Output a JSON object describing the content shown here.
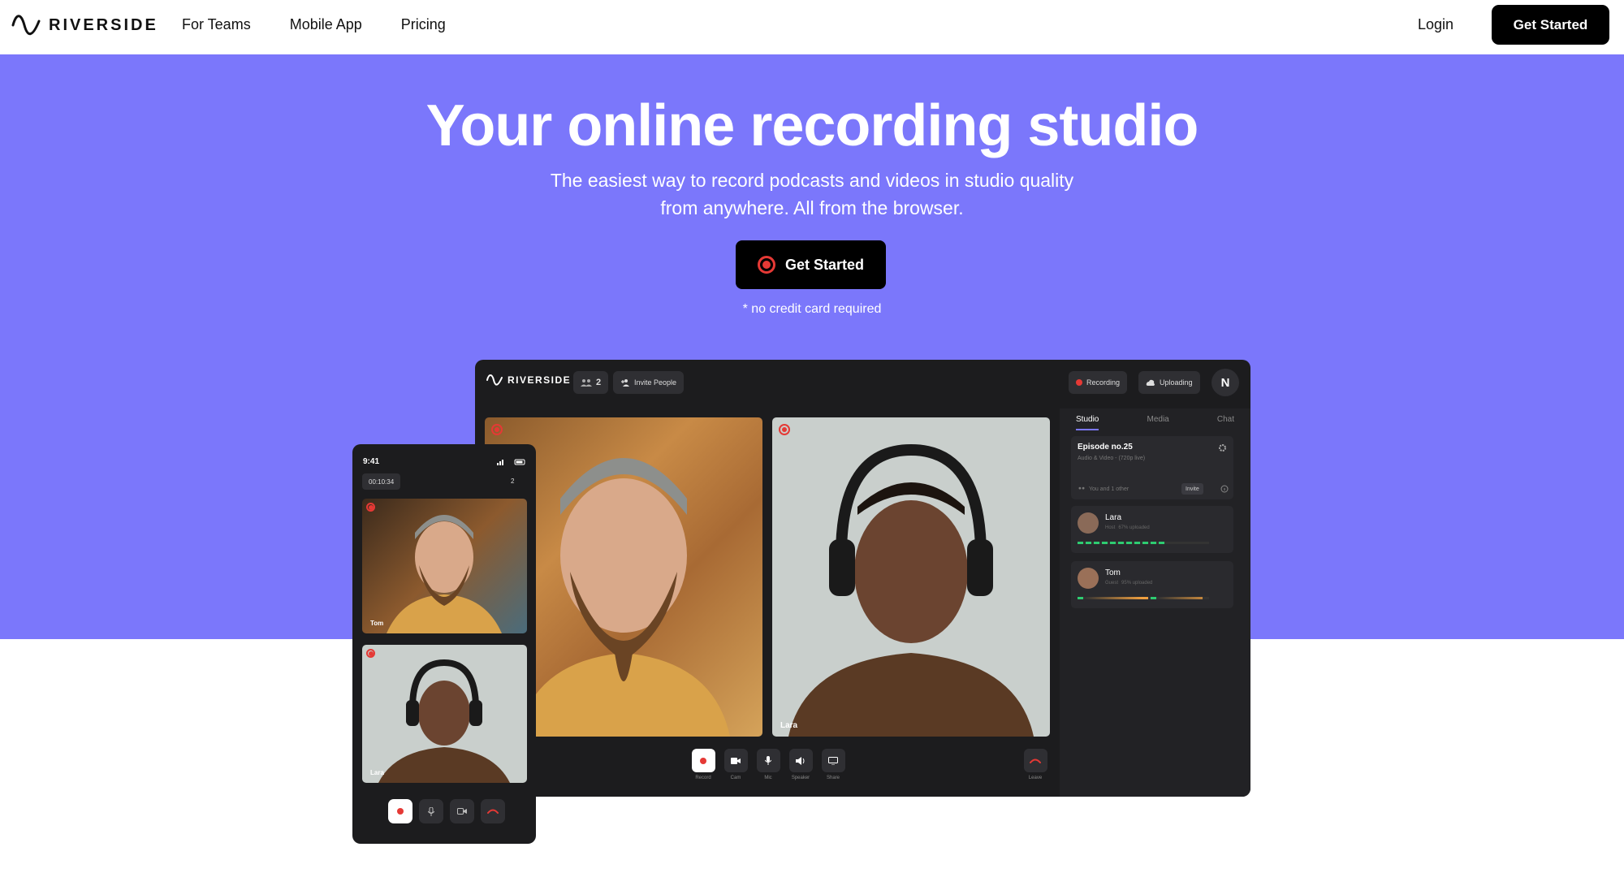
{
  "nav": {
    "brand": "RIVERSIDE",
    "links": [
      "For Teams",
      "Mobile App",
      "Pricing"
    ],
    "login": "Login",
    "cta": "Get Started"
  },
  "hero": {
    "title": "Your online recording studio",
    "subtitle_line1": "The easiest way to record podcasts and videos in studio quality",
    "subtitle_line2": "from anywhere. All from the browser.",
    "cta": "Get Started",
    "note": "* no credit card required",
    "background_color": "#7b77fb"
  },
  "studio_mockup": {
    "brand": "RIVERSIDE",
    "participants_count": "2",
    "invite_label": "Invite People",
    "recording_label": "Recording",
    "uploading_label": "Uploading",
    "avatar_initial": "N",
    "video_names": [
      "Lara"
    ],
    "controls": [
      "Record",
      "Cam",
      "Mic",
      "Speaker",
      "Share"
    ],
    "leave_label": "Leave",
    "tabs": [
      "Studio",
      "Media",
      "Chat"
    ],
    "active_tab": "Studio",
    "episode": {
      "title": "Episode no.25",
      "subtitle": "Audio & Video - (720p live)",
      "participants_text": "You and 1 other",
      "invite_label": "Invite"
    },
    "uploads": [
      {
        "name": "Lara",
        "role": "Host",
        "status": "67% uploaded",
        "progress": 0.67
      },
      {
        "name": "Tom",
        "role": "Guest",
        "status": "95% uploaded",
        "progress": 0.95
      }
    ]
  },
  "phone_mockup": {
    "time": "9:41",
    "timer": "00:10:34",
    "participants_count": "2",
    "video_names": [
      "Tom",
      "Lara"
    ]
  }
}
